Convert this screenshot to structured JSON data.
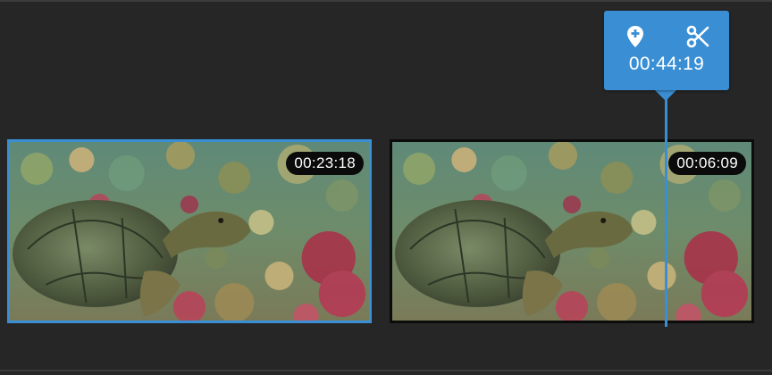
{
  "timeline": {
    "clips": [
      {
        "duration": "00:23:18",
        "selected": true
      },
      {
        "duration": "00:06:09",
        "selected": false
      }
    ],
    "playhead": {
      "time": "00:44:19",
      "add_marker_icon": "map-pin-plus-icon",
      "split_icon": "scissors-icon"
    }
  },
  "colors": {
    "accent": "#3a8fd4",
    "background": "#262626",
    "badge": "#0b0b0b"
  }
}
